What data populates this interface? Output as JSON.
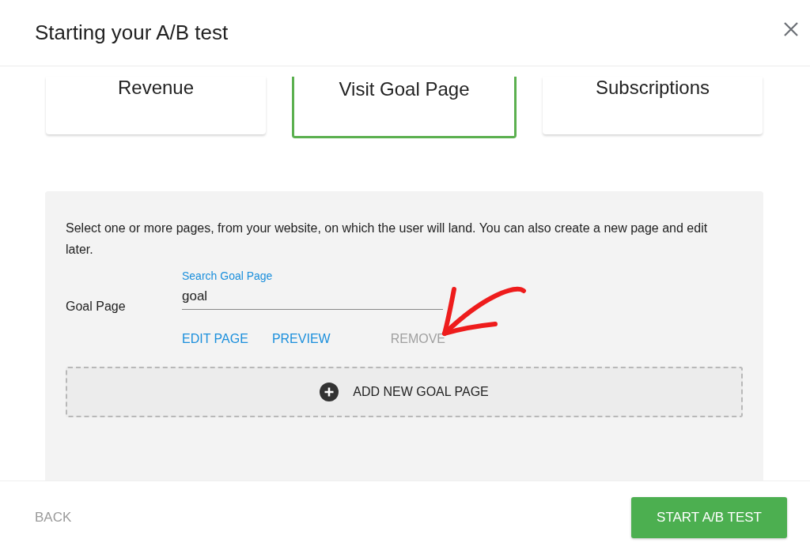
{
  "window": {
    "title": "Starting your A/B test"
  },
  "goal_types": [
    {
      "label": "Revenue",
      "selected": false
    },
    {
      "label": "Visit Goal Page",
      "selected": true
    },
    {
      "label": "Subscriptions",
      "selected": false
    }
  ],
  "panel": {
    "description": "Select one or more pages, from your website, on which the user will land. You can also create a new page and edit later.",
    "goal_page": {
      "label": "Goal Page",
      "field_label": "Search Goal Page",
      "value": "goal"
    },
    "actions": [
      {
        "label": "EDIT PAGE",
        "disabled": false
      },
      {
        "label": "PREVIEW",
        "disabled": false
      },
      {
        "label": "REMOVE",
        "disabled": true
      }
    ],
    "add_button": "ADD NEW GOAL PAGE"
  },
  "footer": {
    "back": "BACK",
    "primary": "START A/B TEST"
  }
}
